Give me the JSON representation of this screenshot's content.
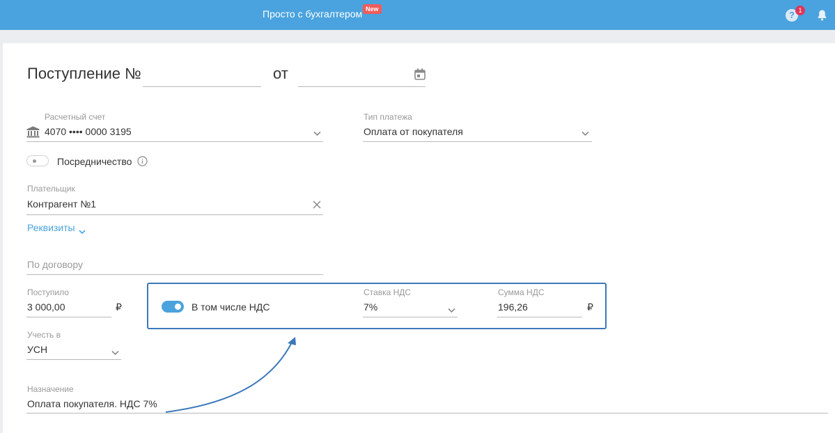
{
  "header": {
    "brand": "Просто с бухгалтером",
    "new_badge": "New",
    "help_count": "1",
    "help_symbol": "?"
  },
  "form": {
    "title": "Поступление №",
    "number_value": "",
    "date_label": "от",
    "date_value": "",
    "account": {
      "label": "Расчетный счет",
      "value": "4070 •••• 0000 3195"
    },
    "payment_type": {
      "label": "Тип платежа",
      "value": "Оплата от покупателя"
    },
    "intermediary": {
      "label": "Посредничество",
      "enabled": false
    },
    "payer": {
      "label": "Плательщик",
      "value": "Контрагент №1"
    },
    "details_link": "Реквизиты",
    "contract": {
      "placeholder": "По договору",
      "value": ""
    },
    "received": {
      "label": "Поступило",
      "value": "3 000,00",
      "currency": "₽"
    },
    "vat": {
      "toggle_label": "В том числе НДС",
      "enabled": true,
      "rate": {
        "label": "Ставка НДС",
        "value": "7%"
      },
      "amount": {
        "label": "Сумма НДС",
        "value": "196,26",
        "currency": "₽"
      }
    },
    "account_in": {
      "label": "Учесть в",
      "value": "УСН"
    },
    "purpose": {
      "label": "Назначение",
      "value": "Оплата покупателя. НДС 7%"
    }
  },
  "colors": {
    "topbar": "#4aa3de",
    "accent": "#4aa3de",
    "highlight_box": "#3a78b9",
    "badge": "#f25b5b"
  }
}
